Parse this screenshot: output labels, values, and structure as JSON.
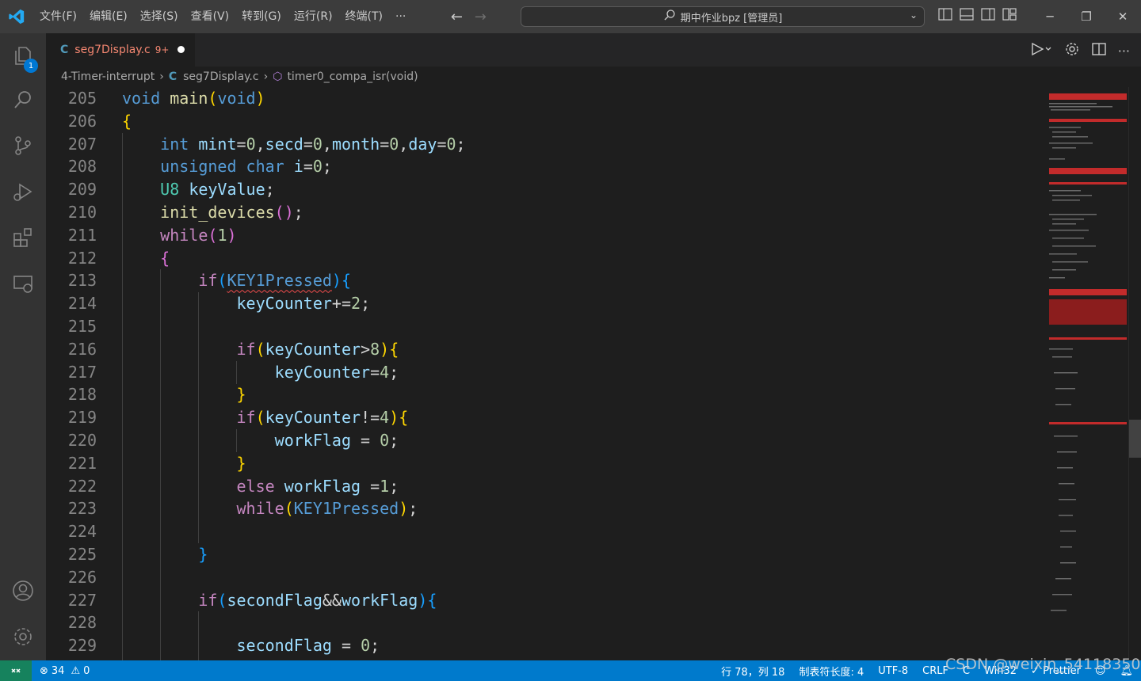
{
  "titlebar": {
    "menu": [
      "文件(F)",
      "编辑(E)",
      "选择(S)",
      "查看(V)",
      "转到(G)",
      "运行(R)",
      "终端(T)",
      "···"
    ],
    "search_text": "期中作业bpz [管理员]"
  },
  "activity": {
    "explorer_badge": "1"
  },
  "tab": {
    "ext": "C",
    "name": "seg7Display.c",
    "problems": "9+"
  },
  "breadcrumb": {
    "folder": "4-Timer-interrupt",
    "file_ext": "C",
    "file": "seg7Display.c",
    "symbol": "timer0_compa_isr(void)"
  },
  "editor": {
    "line_numbers": [
      "205",
      "206",
      "207",
      "208",
      "209",
      "210",
      "211",
      "212",
      "213",
      "214",
      "215",
      "216",
      "217",
      "218",
      "219",
      "220",
      "221",
      "222",
      "223",
      "224",
      "225",
      "226",
      "227",
      "228",
      "229"
    ]
  },
  "status": {
    "errors": "34",
    "warnings": "0",
    "position": "行 78，列 18",
    "tab_size": "制表符长度: 4",
    "encoding": "UTF-8",
    "eol": "CRLF",
    "language": "C",
    "platform": "Win32",
    "formatter": "Prettier"
  },
  "watermark": "CSDN @weixin_54118350",
  "colors": {
    "accent": "#007acc",
    "remote": "#16825d",
    "error": "#f14c4c"
  }
}
